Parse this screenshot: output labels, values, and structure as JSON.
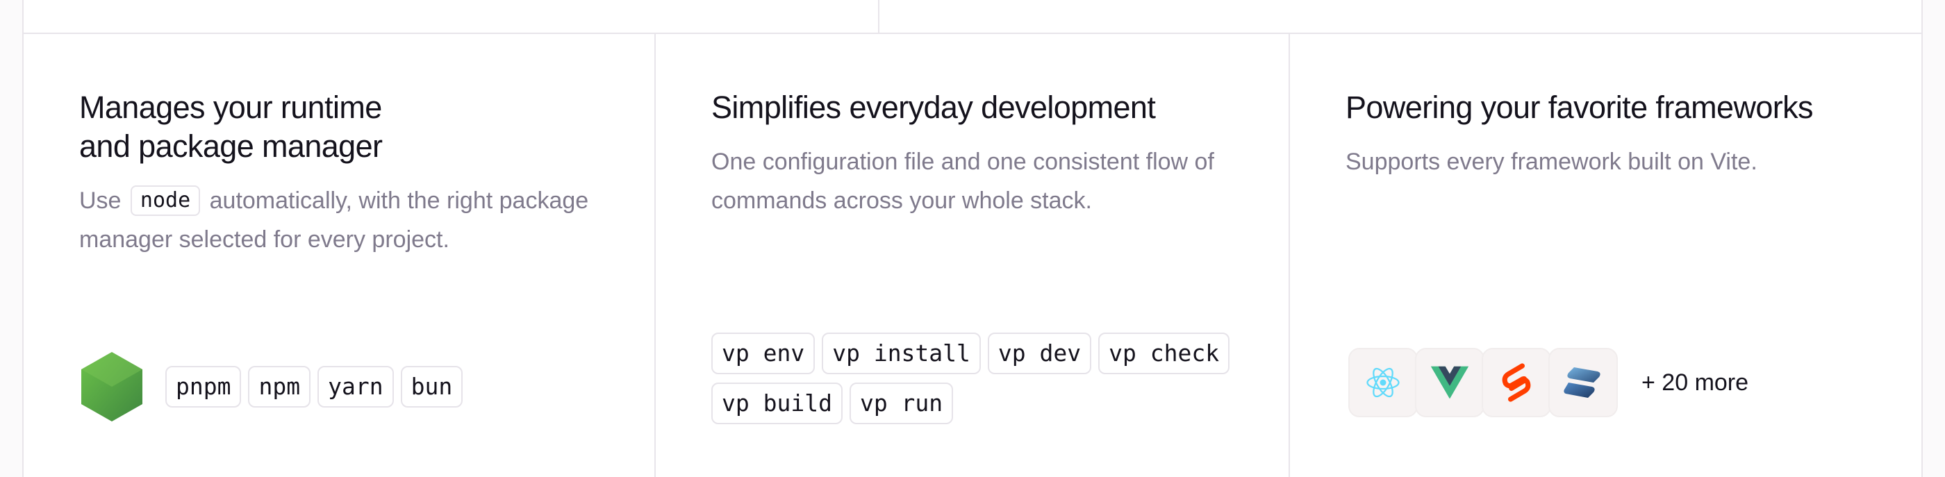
{
  "cards": [
    {
      "title_line1": "Manages your runtime",
      "title_line2": "and package manager",
      "desc_before": "Use",
      "desc_code": "node",
      "desc_after": "automatically, with the right package manager selected for every project.",
      "package_managers": [
        "pnpm",
        "npm",
        "yarn",
        "bun"
      ],
      "logo_icon": "nodejs-icon"
    },
    {
      "title": "Simplifies everyday development",
      "desc": "One configuration file and one consistent flow of commands across your whole stack.",
      "commands": [
        "vp env",
        "vp install",
        "vp dev",
        "vp check",
        "vp build",
        "vp run"
      ]
    },
    {
      "title": "Powering your favorite frameworks",
      "desc": "Supports every framework built on Vite.",
      "frameworks": [
        "react-icon",
        "vue-icon",
        "svelte-icon",
        "solid-icon"
      ],
      "more": "+ 20 more"
    }
  ],
  "colors": {
    "title": "#14121c",
    "muted": "#7f7a8c",
    "border": "#e8e5ea",
    "react": "#61dafb",
    "vue_green": "#41b883",
    "vue_dark": "#35495e",
    "svelte": "#ff3e00",
    "solid": "#446b9e",
    "node": "#539e43"
  }
}
